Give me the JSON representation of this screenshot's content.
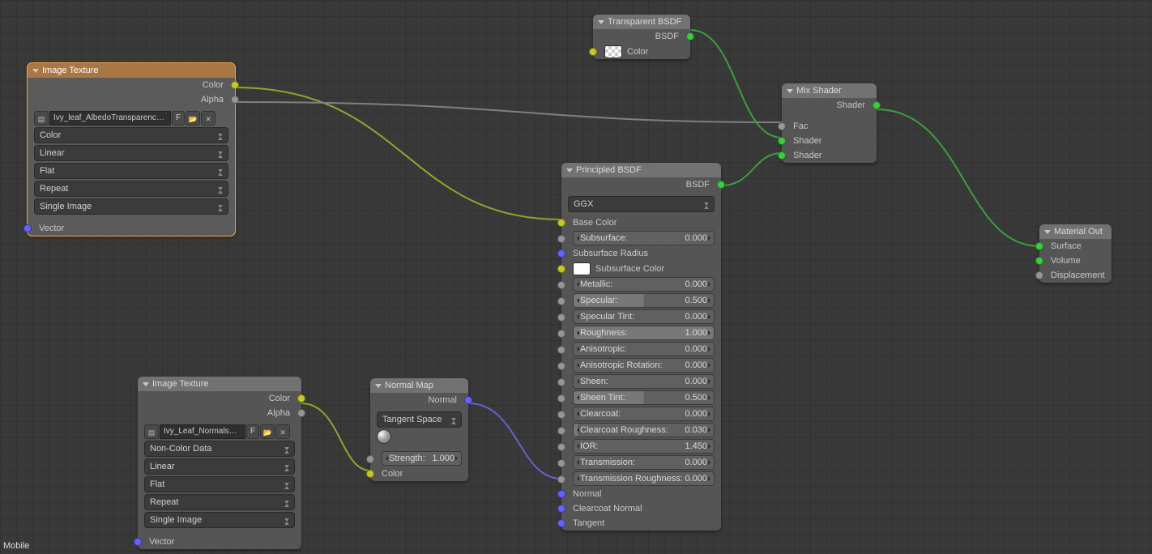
{
  "watermark": "Mobile",
  "nodes": {
    "img1": {
      "title": "Image Texture",
      "out_color": "Color",
      "out_alpha": "Alpha",
      "img_name": "Ivy_leaf_AlbedoTransparency....",
      "fake_user": "F",
      "color_space": "Color",
      "interp": "Linear",
      "proj": "Flat",
      "ext": "Repeat",
      "source": "Single Image",
      "in_vector": "Vector"
    },
    "img2": {
      "title": "Image Texture",
      "out_color": "Color",
      "out_alpha": "Alpha",
      "img_name": "Ivy_Leaf_NormalsM...",
      "fake_user": "F",
      "color_space": "Non-Color Data",
      "interp": "Linear",
      "proj": "Flat",
      "ext": "Repeat",
      "source": "Single Image",
      "in_vector": "Vector"
    },
    "normalmap": {
      "title": "Normal Map",
      "out_normal": "Normal",
      "space": "Tangent Space",
      "strength_label": "Strength:",
      "strength_value": "1.000",
      "in_color": "Color"
    },
    "transparent": {
      "title": "Transparent BSDF",
      "out_bsdf": "BSDF",
      "in_color": "Color"
    },
    "mix": {
      "title": "Mix Shader",
      "out_shader": "Shader",
      "in_fac": "Fac",
      "in_shader1": "Shader",
      "in_shader2": "Shader"
    },
    "matout": {
      "title": "Material Out",
      "surface": "Surface",
      "volume": "Volume",
      "displacement": "Displacement"
    },
    "principled": {
      "title": "Principled BSDF",
      "out_bsdf": "BSDF",
      "distribution": "GGX",
      "base_color": "Base Color",
      "subsurface_radius": "Subsurface Radius",
      "subsurface_color": "Subsurface Color",
      "sliders": [
        {
          "label": "Subsurface:",
          "value": "0.000",
          "fill": 0
        },
        {
          "label": "Metallic:",
          "value": "0.000",
          "fill": 0
        },
        {
          "label": "Specular:",
          "value": "0.500",
          "fill": 50
        },
        {
          "label": "Specular Tint:",
          "value": "0.000",
          "fill": 0
        },
        {
          "label": "Roughness:",
          "value": "1.000",
          "fill": 100
        },
        {
          "label": "Anisotropic:",
          "value": "0.000",
          "fill": 0
        },
        {
          "label": "Anisotropic Rotation:",
          "value": "0.000",
          "fill": 0
        },
        {
          "label": "Sheen:",
          "value": "0.000",
          "fill": 0
        },
        {
          "label": "Sheen Tint:",
          "value": "0.500",
          "fill": 50
        },
        {
          "label": "Clearcoat:",
          "value": "0.000",
          "fill": 0
        },
        {
          "label": "Clearcoat Roughness:",
          "value": "0.030",
          "fill": 3
        },
        {
          "label": "IOR:",
          "value": "1.450",
          "fill": 0
        },
        {
          "label": "Transmission:",
          "value": "0.000",
          "fill": 0
        },
        {
          "label": "Transmission Roughness:",
          "value": "0.000",
          "fill": 0
        }
      ],
      "normal": "Normal",
      "clearcoat_normal": "Clearcoat Normal",
      "tangent": "Tangent"
    }
  }
}
